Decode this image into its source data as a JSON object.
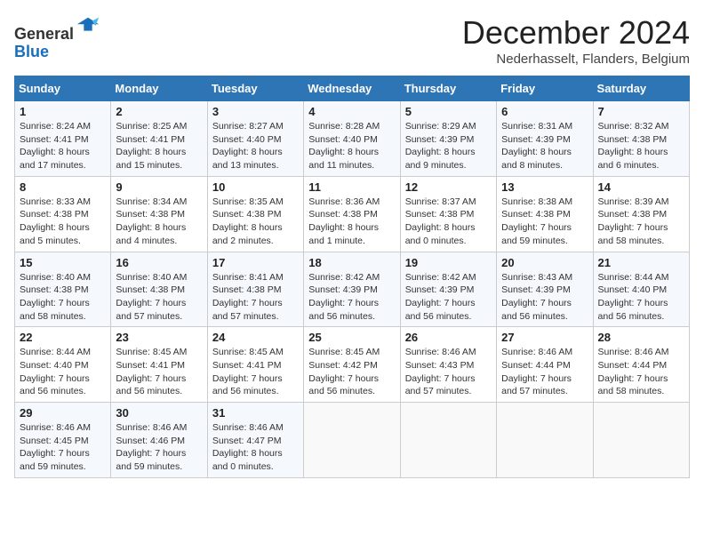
{
  "header": {
    "logo_line1": "General",
    "logo_line2": "Blue",
    "month_title": "December 2024",
    "location": "Nederhasselt, Flanders, Belgium"
  },
  "weekdays": [
    "Sunday",
    "Monday",
    "Tuesday",
    "Wednesday",
    "Thursday",
    "Friday",
    "Saturday"
  ],
  "weeks": [
    [
      {
        "day": "1",
        "info": "Sunrise: 8:24 AM\nSunset: 4:41 PM\nDaylight: 8 hours\nand 17 minutes."
      },
      {
        "day": "2",
        "info": "Sunrise: 8:25 AM\nSunset: 4:41 PM\nDaylight: 8 hours\nand 15 minutes."
      },
      {
        "day": "3",
        "info": "Sunrise: 8:27 AM\nSunset: 4:40 PM\nDaylight: 8 hours\nand 13 minutes."
      },
      {
        "day": "4",
        "info": "Sunrise: 8:28 AM\nSunset: 4:40 PM\nDaylight: 8 hours\nand 11 minutes."
      },
      {
        "day": "5",
        "info": "Sunrise: 8:29 AM\nSunset: 4:39 PM\nDaylight: 8 hours\nand 9 minutes."
      },
      {
        "day": "6",
        "info": "Sunrise: 8:31 AM\nSunset: 4:39 PM\nDaylight: 8 hours\nand 8 minutes."
      },
      {
        "day": "7",
        "info": "Sunrise: 8:32 AM\nSunset: 4:38 PM\nDaylight: 8 hours\nand 6 minutes."
      }
    ],
    [
      {
        "day": "8",
        "info": "Sunrise: 8:33 AM\nSunset: 4:38 PM\nDaylight: 8 hours\nand 5 minutes."
      },
      {
        "day": "9",
        "info": "Sunrise: 8:34 AM\nSunset: 4:38 PM\nDaylight: 8 hours\nand 4 minutes."
      },
      {
        "day": "10",
        "info": "Sunrise: 8:35 AM\nSunset: 4:38 PM\nDaylight: 8 hours\nand 2 minutes."
      },
      {
        "day": "11",
        "info": "Sunrise: 8:36 AM\nSunset: 4:38 PM\nDaylight: 8 hours\nand 1 minute."
      },
      {
        "day": "12",
        "info": "Sunrise: 8:37 AM\nSunset: 4:38 PM\nDaylight: 8 hours\nand 0 minutes."
      },
      {
        "day": "13",
        "info": "Sunrise: 8:38 AM\nSunset: 4:38 PM\nDaylight: 7 hours\nand 59 minutes."
      },
      {
        "day": "14",
        "info": "Sunrise: 8:39 AM\nSunset: 4:38 PM\nDaylight: 7 hours\nand 58 minutes."
      }
    ],
    [
      {
        "day": "15",
        "info": "Sunrise: 8:40 AM\nSunset: 4:38 PM\nDaylight: 7 hours\nand 58 minutes."
      },
      {
        "day": "16",
        "info": "Sunrise: 8:40 AM\nSunset: 4:38 PM\nDaylight: 7 hours\nand 57 minutes."
      },
      {
        "day": "17",
        "info": "Sunrise: 8:41 AM\nSunset: 4:38 PM\nDaylight: 7 hours\nand 57 minutes."
      },
      {
        "day": "18",
        "info": "Sunrise: 8:42 AM\nSunset: 4:39 PM\nDaylight: 7 hours\nand 56 minutes."
      },
      {
        "day": "19",
        "info": "Sunrise: 8:42 AM\nSunset: 4:39 PM\nDaylight: 7 hours\nand 56 minutes."
      },
      {
        "day": "20",
        "info": "Sunrise: 8:43 AM\nSunset: 4:39 PM\nDaylight: 7 hours\nand 56 minutes."
      },
      {
        "day": "21",
        "info": "Sunrise: 8:44 AM\nSunset: 4:40 PM\nDaylight: 7 hours\nand 56 minutes."
      }
    ],
    [
      {
        "day": "22",
        "info": "Sunrise: 8:44 AM\nSunset: 4:40 PM\nDaylight: 7 hours\nand 56 minutes."
      },
      {
        "day": "23",
        "info": "Sunrise: 8:45 AM\nSunset: 4:41 PM\nDaylight: 7 hours\nand 56 minutes."
      },
      {
        "day": "24",
        "info": "Sunrise: 8:45 AM\nSunset: 4:41 PM\nDaylight: 7 hours\nand 56 minutes."
      },
      {
        "day": "25",
        "info": "Sunrise: 8:45 AM\nSunset: 4:42 PM\nDaylight: 7 hours\nand 56 minutes."
      },
      {
        "day": "26",
        "info": "Sunrise: 8:46 AM\nSunset: 4:43 PM\nDaylight: 7 hours\nand 57 minutes."
      },
      {
        "day": "27",
        "info": "Sunrise: 8:46 AM\nSunset: 4:44 PM\nDaylight: 7 hours\nand 57 minutes."
      },
      {
        "day": "28",
        "info": "Sunrise: 8:46 AM\nSunset: 4:44 PM\nDaylight: 7 hours\nand 58 minutes."
      }
    ],
    [
      {
        "day": "29",
        "info": "Sunrise: 8:46 AM\nSunset: 4:45 PM\nDaylight: 7 hours\nand 59 minutes."
      },
      {
        "day": "30",
        "info": "Sunrise: 8:46 AM\nSunset: 4:46 PM\nDaylight: 7 hours\nand 59 minutes."
      },
      {
        "day": "31",
        "info": "Sunrise: 8:46 AM\nSunset: 4:47 PM\nDaylight: 8 hours\nand 0 minutes."
      },
      {
        "day": "",
        "info": ""
      },
      {
        "day": "",
        "info": ""
      },
      {
        "day": "",
        "info": ""
      },
      {
        "day": "",
        "info": ""
      }
    ]
  ]
}
